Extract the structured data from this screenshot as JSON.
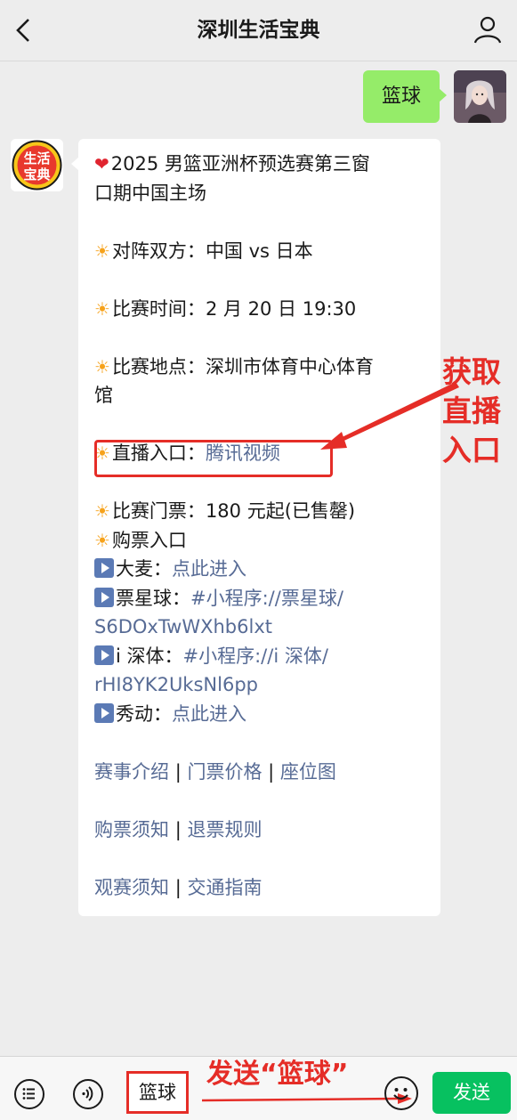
{
  "header": {
    "title": "深圳生活宝典",
    "back_icon": "chevron-left-icon",
    "profile_icon": "person-icon"
  },
  "user_message": {
    "text": "篮球"
  },
  "bot_message": {
    "avatar_text": [
      "生活",
      "宝典"
    ],
    "heading_line1": "2025 男篮亚洲杯预选赛第三窗",
    "heading_line2": "口期中国主场",
    "teams_label": "对阵双方：",
    "teams_value": "中国 vs 日本",
    "time_label": "比赛时间：",
    "time_value": "2 月 20 日 19:30",
    "venue_label": "比赛地点：",
    "venue_value_line1": "深圳市体育中心体育",
    "venue_value_line2": "馆",
    "live_label": "直播入口：",
    "live_link": "腾讯视频",
    "ticket_label": "比赛门票：",
    "ticket_value": "180 元起(已售罄)",
    "buy_label": "购票入口",
    "damai_label": "大麦：",
    "damai_link": "点此进入",
    "piaoxingqiu_label": "票星球：",
    "piaoxingqiu_link_line1": "#小程序://票星球/",
    "piaoxingqiu_link_line2": "S6DOxTwWXhb6lxt",
    "ishenti_label": "i 深体：",
    "ishenti_link_line1": "#小程序://i 深体/",
    "ishenti_link_line2": "rHI8YK2UksNl6pp",
    "xiudong_label": "秀动：",
    "xiudong_link": "点此进入",
    "links_row1": [
      "赛事介绍",
      "门票价格",
      "座位图"
    ],
    "links_row2": [
      "购票须知",
      "退票规则"
    ],
    "links_row3": [
      "观赛须知",
      "交通指南"
    ],
    "separator": "|"
  },
  "annotations": {
    "live_entry_line1": "获取",
    "live_entry_line2": "直播",
    "live_entry_line3": "入口",
    "send_hint": "发送“篮球”"
  },
  "bottom_bar": {
    "menu_icon": "menu-list-icon",
    "voice_icon": "voice-icon",
    "input_value": "篮球",
    "emoji_icon": "emoji-icon",
    "send_label": "发送"
  },
  "colors": {
    "accent_green": "#07c160",
    "bubble_green": "#95ec69",
    "link_blue": "#576b95",
    "annotation_red": "#e52d27"
  }
}
